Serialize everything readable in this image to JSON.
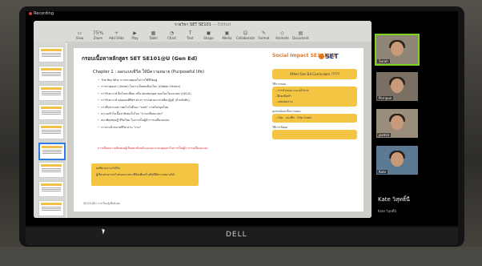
{
  "recording": {
    "label": "Recording"
  },
  "keynote": {
    "title": "รายวิชา SET SE101",
    "status": "— Edited",
    "toolbar": [
      {
        "label": "View",
        "glyph": "▭"
      },
      {
        "label": "Zoom",
        "glyph": "75%"
      },
      {
        "label": "Add Slide",
        "glyph": "+"
      },
      {
        "label": "Play",
        "glyph": "▶"
      },
      {
        "label": "Table",
        "glyph": "▦"
      },
      {
        "label": "Chart",
        "glyph": "◔"
      },
      {
        "label": "Text",
        "glyph": "T"
      },
      {
        "label": "Shape",
        "glyph": "◼"
      },
      {
        "label": "Media",
        "glyph": "▣"
      },
      {
        "label": "Collaborate",
        "glyph": "☺"
      },
      {
        "label": "Format",
        "glyph": "✎"
      },
      {
        "label": "Animate",
        "glyph": "◇"
      },
      {
        "label": "Document",
        "glyph": "▤"
      }
    ],
    "slide_numbers": [
      "",
      "",
      "",
      "",
      "",
      "",
      "",
      "",
      ""
    ]
  },
  "slide": {
    "title": "กรอบเนื้อหาหลักสูตร SET SE101@U (Gen Ed)",
    "logo_social": "Social Impact SE101@U",
    "logo_set": "SET",
    "chapter": "Chapter 1 : ออกแบบชีวิต ให้มีความหมาย (Purposeful life)",
    "bullets": [
      "The Big Why การหาเหตุผลในการใช้ชีวิตอยู่",
      "การหาคุณค่า (Value) ในการเป็นพลเมืองโลก (Global Citizen)",
      "การวิเคราะห์ ยีดโลกเปลี่ยน หรือ landscape ของโลกในอนาคต (VUCA)",
      "การวิเคราะห์ คุณลอดพิชิตฯ ต่างๆ ระบบตามการเปลี่ยนรู้ภูมิ (ล้าหลังทัน)",
      "การสื่อสารแห่ง เทคโนโลยีรอง \"core\" ภาพโลกยุคใหม่",
      "ความเข้าใจเนื้อหาสังคมในโลก \"การเปลี่ยนแปลง\"",
      "สมาทิต/ทฤษฎี ชีวิตใหม่ ในการเป็นผู้นำการเปลี่ยนแปลง",
      "การหาเป้าหมายชีวิต ผ่าน \"งาน\""
    ],
    "red_note": "การเชื่อมความคิดของผู้เรียนสะท้อนตัวเองและระบบคุณค่าในการเป็นผู้นำการเปลี่ยนแปลง",
    "yellow_title": "ผลที่คาดว่าจะได้รับ",
    "yellow_text": "ผู้เรียนสามารถกำหนดแนวทางชีวิตเพื่อสร้างสิ่งที่มีความหมายได้",
    "footer": "SE101@U การเรียนรู้เพื่อสังคม",
    "right": {
      "box_title": "Other Gen Ed Curriculum ?????",
      "label1": "วิธีการสอน",
      "items1": [
        "- การนำเสนอ และอภิปราย",
        "- ฝึกลงมือทำ",
        "- แสดงผลงาน"
      ],
      "label2": "อุปกรณ์และสื่อการสอน",
      "items2": "- Clip   - แบบฝึก   - Flip Chart",
      "label3": "วิธีการวัดผล"
    }
  },
  "participants": [
    {
      "name": "Sarah"
    },
    {
      "name": "Pornpun"
    },
    {
      "name": "jasmin"
    },
    {
      "name": "Kate"
    }
  ],
  "active_speaker": {
    "name": "Kate วิสุทธิ์นี",
    "sub": "Kate วิสุทธิ์นี"
  },
  "laptop_brand": "DELL"
}
